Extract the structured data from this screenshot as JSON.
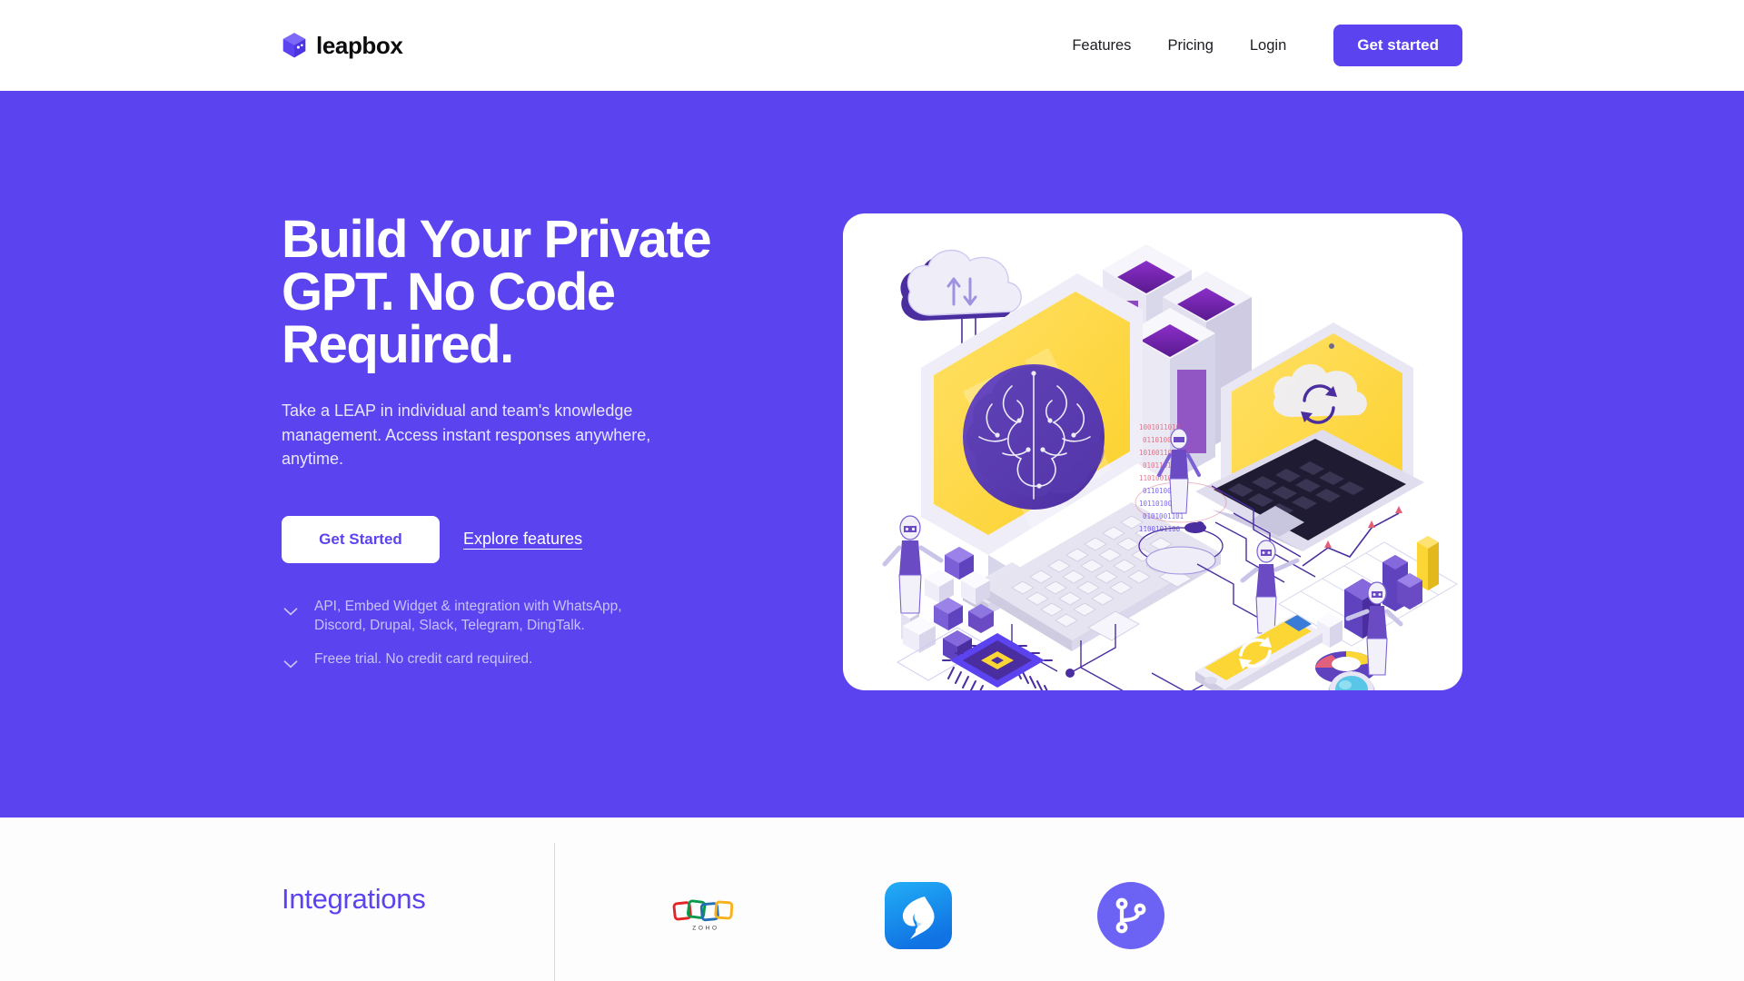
{
  "brand": {
    "name": "leapbox",
    "logo_icon": "cube-icon",
    "accent_color": "#5B43F0"
  },
  "header": {
    "nav": [
      {
        "label": "Features",
        "name": "nav-link-features"
      },
      {
        "label": "Pricing",
        "name": "nav-link-pricing"
      },
      {
        "label": "Login",
        "name": "nav-link-login"
      }
    ],
    "cta_label": "Get started"
  },
  "hero": {
    "title": "Build Your Private GPT. No Code Required.",
    "subtitle": "Take a LEAP in individual and team's knowledge management. Access instant responses anywhere, anytime.",
    "primary_cta": "Get Started",
    "secondary_cta": "Explore features",
    "background_color": "#5B43F0",
    "checks": [
      {
        "icon": "check-icon",
        "text": "API, Embed Widget & integration with WhatsApp, Discord, Drupal, Slack, Telegram, DingTalk."
      },
      {
        "icon": "check-icon",
        "text": "Freee trial. No credit card required."
      }
    ],
    "illustration": {
      "name": "isometric-ai-illustration",
      "alt": "Isometric illustration of AI brain on monitor, servers, laptop, keyboard, robots, charts, smartphone, chip and magnifier",
      "palette": {
        "purple_dark": "#4A2D9E",
        "purple": "#7B5FD6",
        "lavender": "#CFC9F2",
        "yellow": "#FCD635",
        "light": "#EFEEF8"
      }
    }
  },
  "integrations": {
    "title": "Integrations",
    "title_color": "#5B43F0",
    "logos": [
      {
        "name": "zoho-logo",
        "label": "ZOHO",
        "colors": [
          "#E42527",
          "#089949",
          "#226DB4",
          "#F9B21D"
        ]
      },
      {
        "name": "dingtalk-logo",
        "label": "DingTalk",
        "colors": [
          "#1BA9F5",
          "#1477E8"
        ]
      },
      {
        "name": "git-branch-logo",
        "label": "Git",
        "colors": [
          "#6C63F5"
        ]
      }
    ]
  }
}
